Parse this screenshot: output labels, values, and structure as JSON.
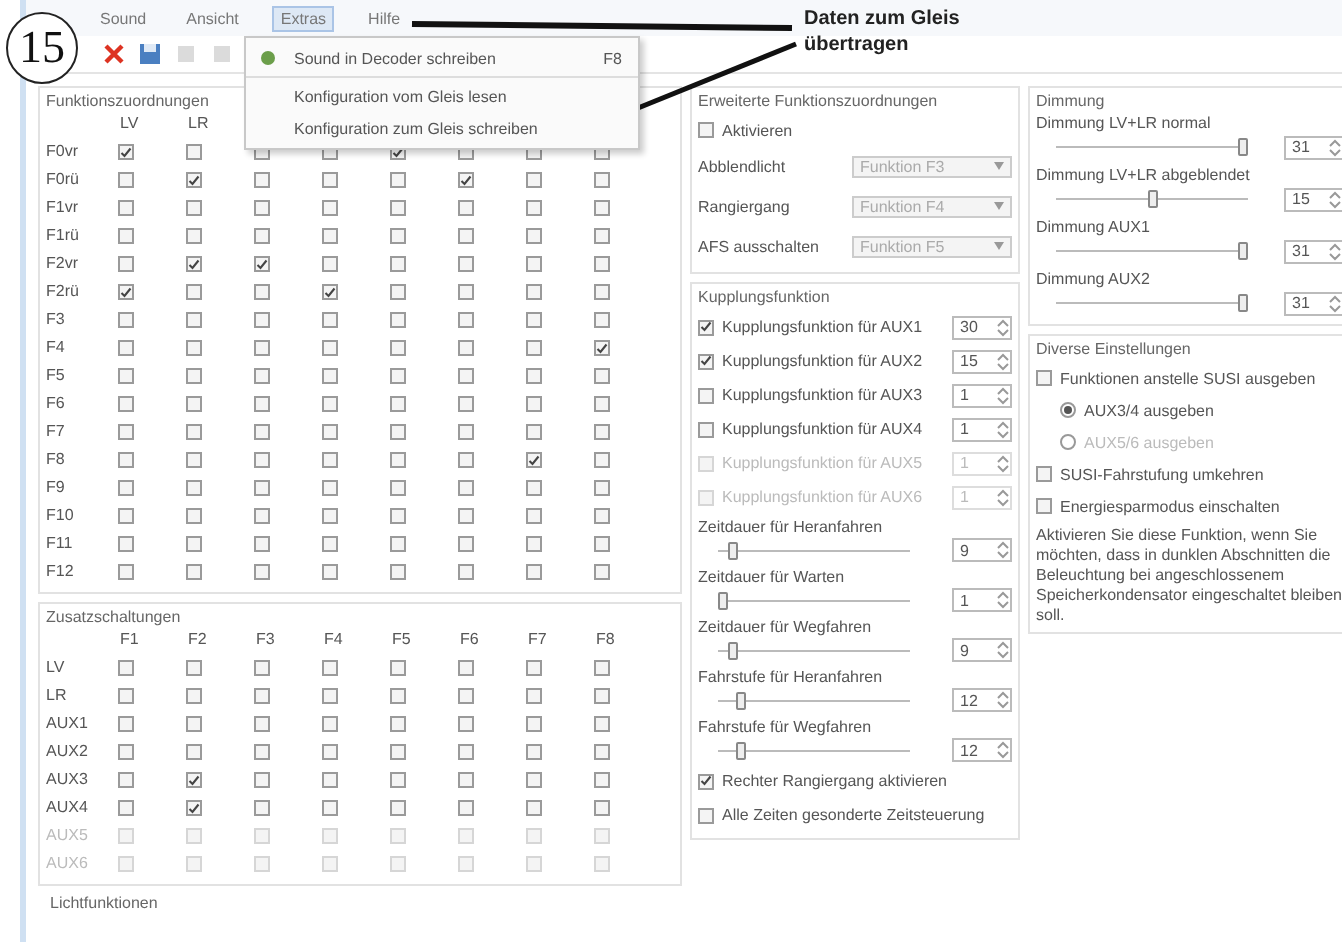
{
  "badge": "15",
  "annotation": "Daten zum Gleis übertragen",
  "menu_bar": [
    {
      "label": "Sound",
      "selected": false
    },
    {
      "label": "Ansicht",
      "selected": false
    },
    {
      "label": "Extras",
      "selected": true
    },
    {
      "label": "Hilfe",
      "selected": false
    }
  ],
  "toolbar": [
    {
      "kind": "delete",
      "disabled": false
    },
    {
      "kind": "save",
      "disabled": false
    },
    {
      "kind": "blank",
      "disabled": true
    },
    {
      "kind": "blank",
      "disabled": true
    }
  ],
  "dropdown": [
    {
      "label": "Sound in Decoder schreiben",
      "shortcut": "F8",
      "icon": true
    },
    {
      "label": "Konfiguration vom Gleis lesen",
      "icon": false
    },
    {
      "label": "Konfiguration zum Gleis schreiben",
      "icon": false
    }
  ],
  "function_mapping": {
    "title": "Funktionszuordnungen",
    "columns": [
      "LV",
      "LR"
    ],
    "rows": [
      {
        "label": "F0vr",
        "disabled": false,
        "cells": [
          true,
          false,
          false,
          false,
          true,
          false,
          false,
          false
        ]
      },
      {
        "label": "F0rü",
        "disabled": false,
        "cells": [
          false,
          true,
          false,
          false,
          false,
          true,
          false,
          false
        ]
      },
      {
        "label": "F1vr",
        "disabled": false,
        "cells": [
          false,
          false,
          false,
          false,
          false,
          false,
          false,
          false
        ]
      },
      {
        "label": "F1rü",
        "disabled": false,
        "cells": [
          false,
          false,
          false,
          false,
          false,
          false,
          false,
          false
        ]
      },
      {
        "label": "F2vr",
        "disabled": false,
        "cells": [
          false,
          true,
          true,
          false,
          false,
          false,
          false,
          false
        ]
      },
      {
        "label": "F2rü",
        "disabled": false,
        "cells": [
          true,
          false,
          false,
          true,
          false,
          false,
          false,
          false
        ]
      },
      {
        "label": "F3",
        "disabled": false,
        "cells": [
          false,
          false,
          false,
          false,
          false,
          false,
          false,
          false
        ]
      },
      {
        "label": "F4",
        "disabled": false,
        "cells": [
          false,
          false,
          false,
          false,
          false,
          false,
          false,
          true
        ]
      },
      {
        "label": "F5",
        "disabled": false,
        "cells": [
          false,
          false,
          false,
          false,
          false,
          false,
          false,
          false
        ]
      },
      {
        "label": "F6",
        "disabled": false,
        "cells": [
          false,
          false,
          false,
          false,
          false,
          false,
          false,
          false
        ]
      },
      {
        "label": "F7",
        "disabled": false,
        "cells": [
          false,
          false,
          false,
          false,
          false,
          false,
          false,
          false
        ]
      },
      {
        "label": "F8",
        "disabled": false,
        "cells": [
          false,
          false,
          false,
          false,
          false,
          false,
          true,
          false
        ]
      },
      {
        "label": "F9",
        "disabled": false,
        "cells": [
          false,
          false,
          false,
          false,
          false,
          false,
          false,
          false
        ]
      },
      {
        "label": "F10",
        "disabled": false,
        "cells": [
          false,
          false,
          false,
          false,
          false,
          false,
          false,
          false
        ]
      },
      {
        "label": "F11",
        "disabled": false,
        "cells": [
          false,
          false,
          false,
          false,
          false,
          false,
          false,
          false
        ]
      },
      {
        "label": "F12",
        "disabled": false,
        "cells": [
          false,
          false,
          false,
          false,
          false,
          false,
          false,
          false
        ]
      }
    ]
  },
  "extra_mapping": {
    "title": "Zusatzschaltungen",
    "columns": [
      "F1",
      "F2",
      "F3",
      "F4",
      "F5",
      "F6",
      "F7",
      "F8"
    ],
    "rows": [
      {
        "label": "LV",
        "disabled": false,
        "cells": [
          false,
          false,
          false,
          false,
          false,
          false,
          false,
          false
        ]
      },
      {
        "label": "LR",
        "disabled": false,
        "cells": [
          false,
          false,
          false,
          false,
          false,
          false,
          false,
          false
        ]
      },
      {
        "label": "AUX1",
        "disabled": false,
        "cells": [
          false,
          false,
          false,
          false,
          false,
          false,
          false,
          false
        ]
      },
      {
        "label": "AUX2",
        "disabled": false,
        "cells": [
          false,
          false,
          false,
          false,
          false,
          false,
          false,
          false
        ]
      },
      {
        "label": "AUX3",
        "disabled": false,
        "cells": [
          false,
          true,
          false,
          false,
          false,
          false,
          false,
          false
        ]
      },
      {
        "label": "AUX4",
        "disabled": false,
        "cells": [
          false,
          true,
          false,
          false,
          false,
          false,
          false,
          false
        ]
      },
      {
        "label": "AUX5",
        "disabled": true,
        "cells": [
          false,
          false,
          false,
          false,
          false,
          false,
          false,
          false
        ]
      },
      {
        "label": "AUX6",
        "disabled": true,
        "cells": [
          false,
          false,
          false,
          false,
          false,
          false,
          false,
          false
        ]
      }
    ]
  },
  "bottom_group_title": "Lichtfunktionen",
  "extended": {
    "title": "Erweiterte Funktionszuordnungen",
    "activate": {
      "label": "Aktivieren",
      "checked": false
    },
    "combos": [
      {
        "label": "Abblendlicht",
        "value": "Funktion F3",
        "disabled": true
      },
      {
        "label": "Rangiergang",
        "value": "Funktion F4",
        "disabled": true
      },
      {
        "label": "AFS ausschalten",
        "value": "Funktion F5",
        "disabled": true
      }
    ]
  },
  "coupling": {
    "title": "Kupplungsfunktion",
    "rows": [
      {
        "label": "Kupplungsfunktion für AUX1",
        "checked": true,
        "disabled": false,
        "value": "30"
      },
      {
        "label": "Kupplungsfunktion für AUX2",
        "checked": true,
        "disabled": false,
        "value": "15"
      },
      {
        "label": "Kupplungsfunktion für AUX3",
        "checked": false,
        "disabled": false,
        "value": "1"
      },
      {
        "label": "Kupplungsfunktion für AUX4",
        "checked": false,
        "disabled": false,
        "value": "1"
      },
      {
        "label": "Kupplungsfunktion für AUX5",
        "checked": false,
        "disabled": true,
        "value": "1"
      },
      {
        "label": "Kupplungsfunktion für AUX6",
        "checked": false,
        "disabled": true,
        "value": "1"
      }
    ],
    "sliders": [
      {
        "label": "Zeitdauer für Heranfahren",
        "level": 0.05,
        "value": "9"
      },
      {
        "label": "Zeitdauer für Warten",
        "level": 0.0,
        "value": "1"
      },
      {
        "label": "Zeitdauer für Wegfahren",
        "level": 0.05,
        "value": "9"
      },
      {
        "label": "Fahrstufe für Heranfahren",
        "level": 0.1,
        "value": "12"
      },
      {
        "label": "Fahrstufe für Wegfahren",
        "level": 0.1,
        "value": "12"
      }
    ],
    "checks": [
      {
        "label": "Rechter Rangiergang aktivieren",
        "checked": true
      },
      {
        "label": "Alle Zeiten gesonderte Zeitsteuerung",
        "checked": false
      }
    ]
  },
  "dimming": {
    "title": "Dimmung",
    "sliders": [
      {
        "label": "Dimmung LV+LR normal",
        "level": 1.0,
        "value": "31"
      },
      {
        "label": "Dimmung LV+LR abgeblendet",
        "level": 0.5,
        "value": "15"
      },
      {
        "label": "Dimmung AUX1",
        "level": 1.0,
        "value": "31"
      },
      {
        "label": "Dimmung AUX2",
        "level": 1.0,
        "value": "31"
      }
    ]
  },
  "misc": {
    "title": "Diverse Einstellungen",
    "items": [
      {
        "kind": "check",
        "label": "Funktionen anstelle SUSI ausgeben",
        "checked": false
      },
      {
        "kind": "radio",
        "label": "AUX3/4 ausgeben",
        "selected": true
      },
      {
        "kind": "radio",
        "label": "AUX5/6 ausgeben",
        "selected": false
      },
      {
        "kind": "check",
        "label": "SUSI-Fahrstufung umkehren",
        "checked": false
      },
      {
        "kind": "check",
        "label": "Energiesparmodus einschalten",
        "checked": false
      }
    ],
    "note": "Aktivieren Sie diese Funktion, wenn Sie möchten, dass in dunklen Abschnitten die Beleuchtung bei angeschlossenem Speicherkondensator eingeschaltet bleiben soll."
  }
}
